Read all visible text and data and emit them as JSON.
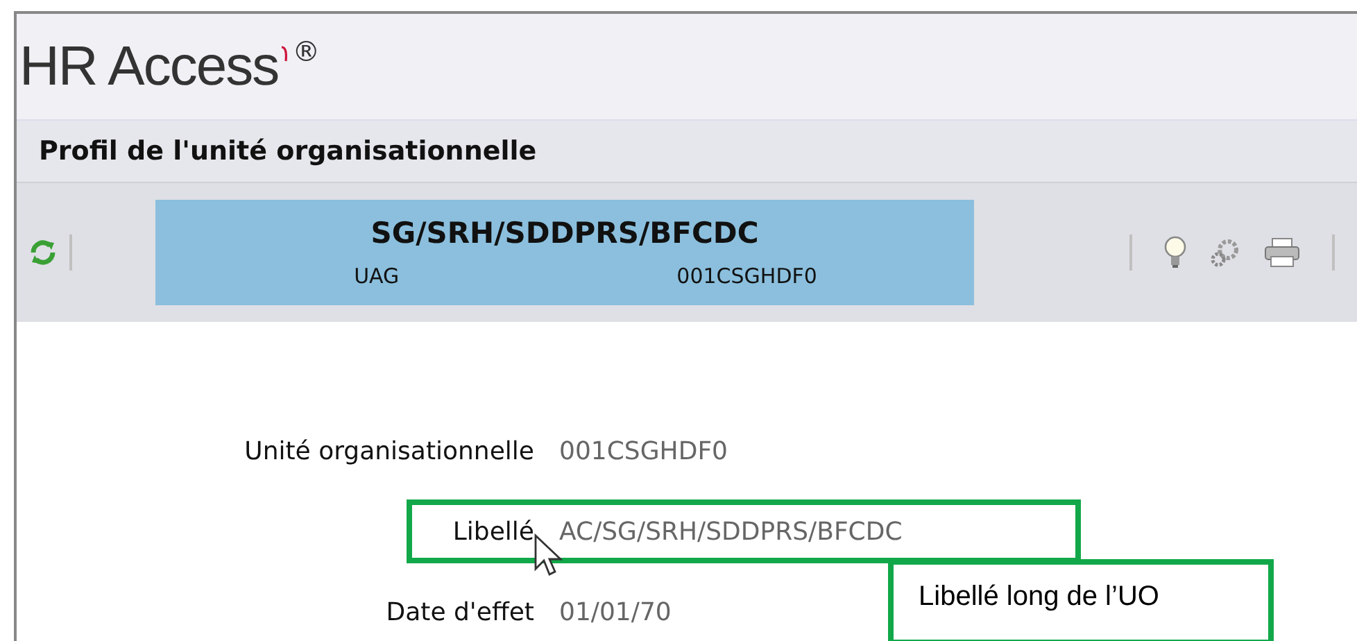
{
  "app": {
    "logo": "HR Access",
    "trademark": "®"
  },
  "page_title": "Profil de l'unité organisationnelle",
  "banner": {
    "title": "SG/SRH/SDDPRS/BFCDC",
    "type": "UAG",
    "code": "001CSGHDF0"
  },
  "fields": [
    {
      "label": "Unité organisationnelle",
      "value": "001CSGHDF0",
      "highlighted": false
    },
    {
      "label": "Libellé",
      "value": "AC/SG/SRH/SDDPRS/BFCDC",
      "highlighted": true
    },
    {
      "label": "Date d'effet",
      "value": "01/01/70",
      "highlighted": false
    }
  ],
  "callout": "Libellé long de l’UO"
}
